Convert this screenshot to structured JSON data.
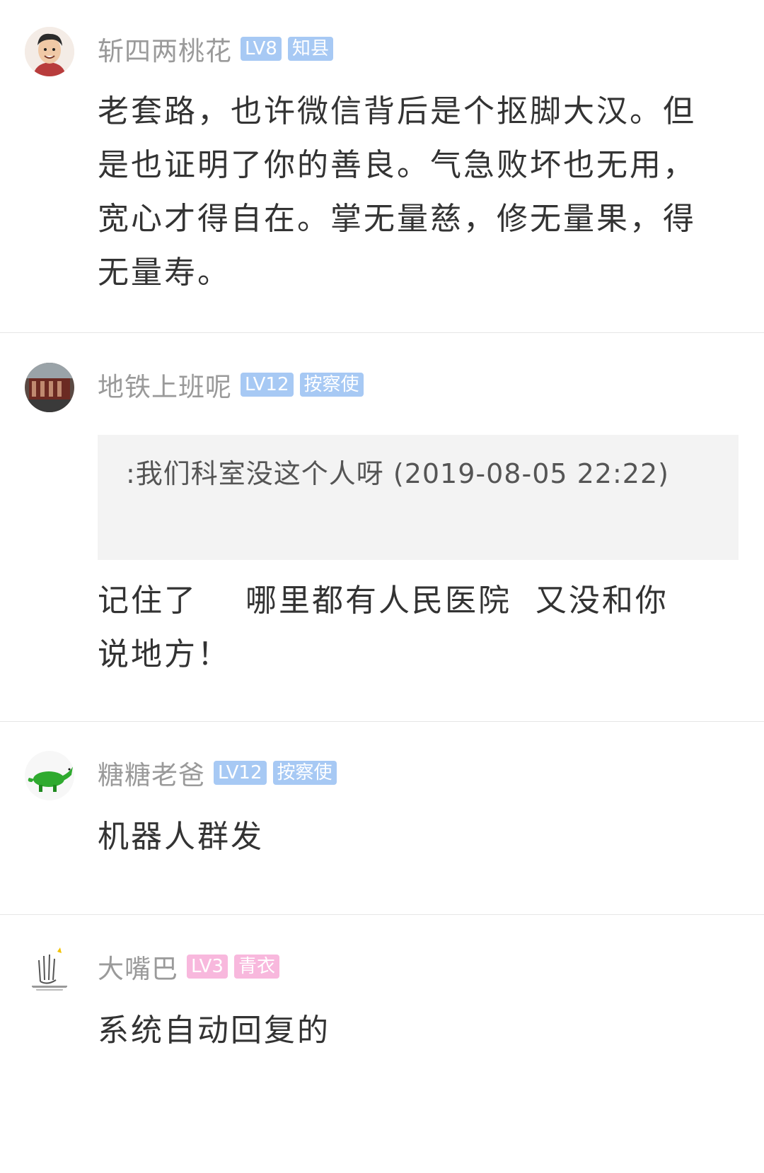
{
  "comments": [
    {
      "username": "斩四两桃花",
      "level": "LV8",
      "title": "知县",
      "badge_color": "#a7c9f4",
      "avatar_icon": "cartoon-man-avatar",
      "text": "老套路，也许微信背后是个抠脚大汉。但是也证明了你的善良。气急败坏也无用，宽心才得自在。掌无量慈，修无量果，得无量寿。"
    },
    {
      "username": "地铁上班呢",
      "level": "LV12",
      "title": "按察使",
      "badge_color": "#a7c9f4",
      "avatar_icon": "building-photo-avatar",
      "quote": ":我们科室没这个人呀 (2019-08-05 22:22)",
      "text": "记住了    哪里都有人民医院  又没和你说地方！"
    },
    {
      "username": "糖糖老爸",
      "level": "LV12",
      "title": "按察使",
      "badge_color": "#a7c9f4",
      "avatar_icon": "green-dinosaur-avatar",
      "text": "机器人群发"
    },
    {
      "username": "大嘴巴",
      "level": "LV3",
      "title": "青衣",
      "badge_color": "#f8b8dd",
      "avatar_icon": "sketch-hand-avatar",
      "text": "系统自动回复的"
    }
  ]
}
